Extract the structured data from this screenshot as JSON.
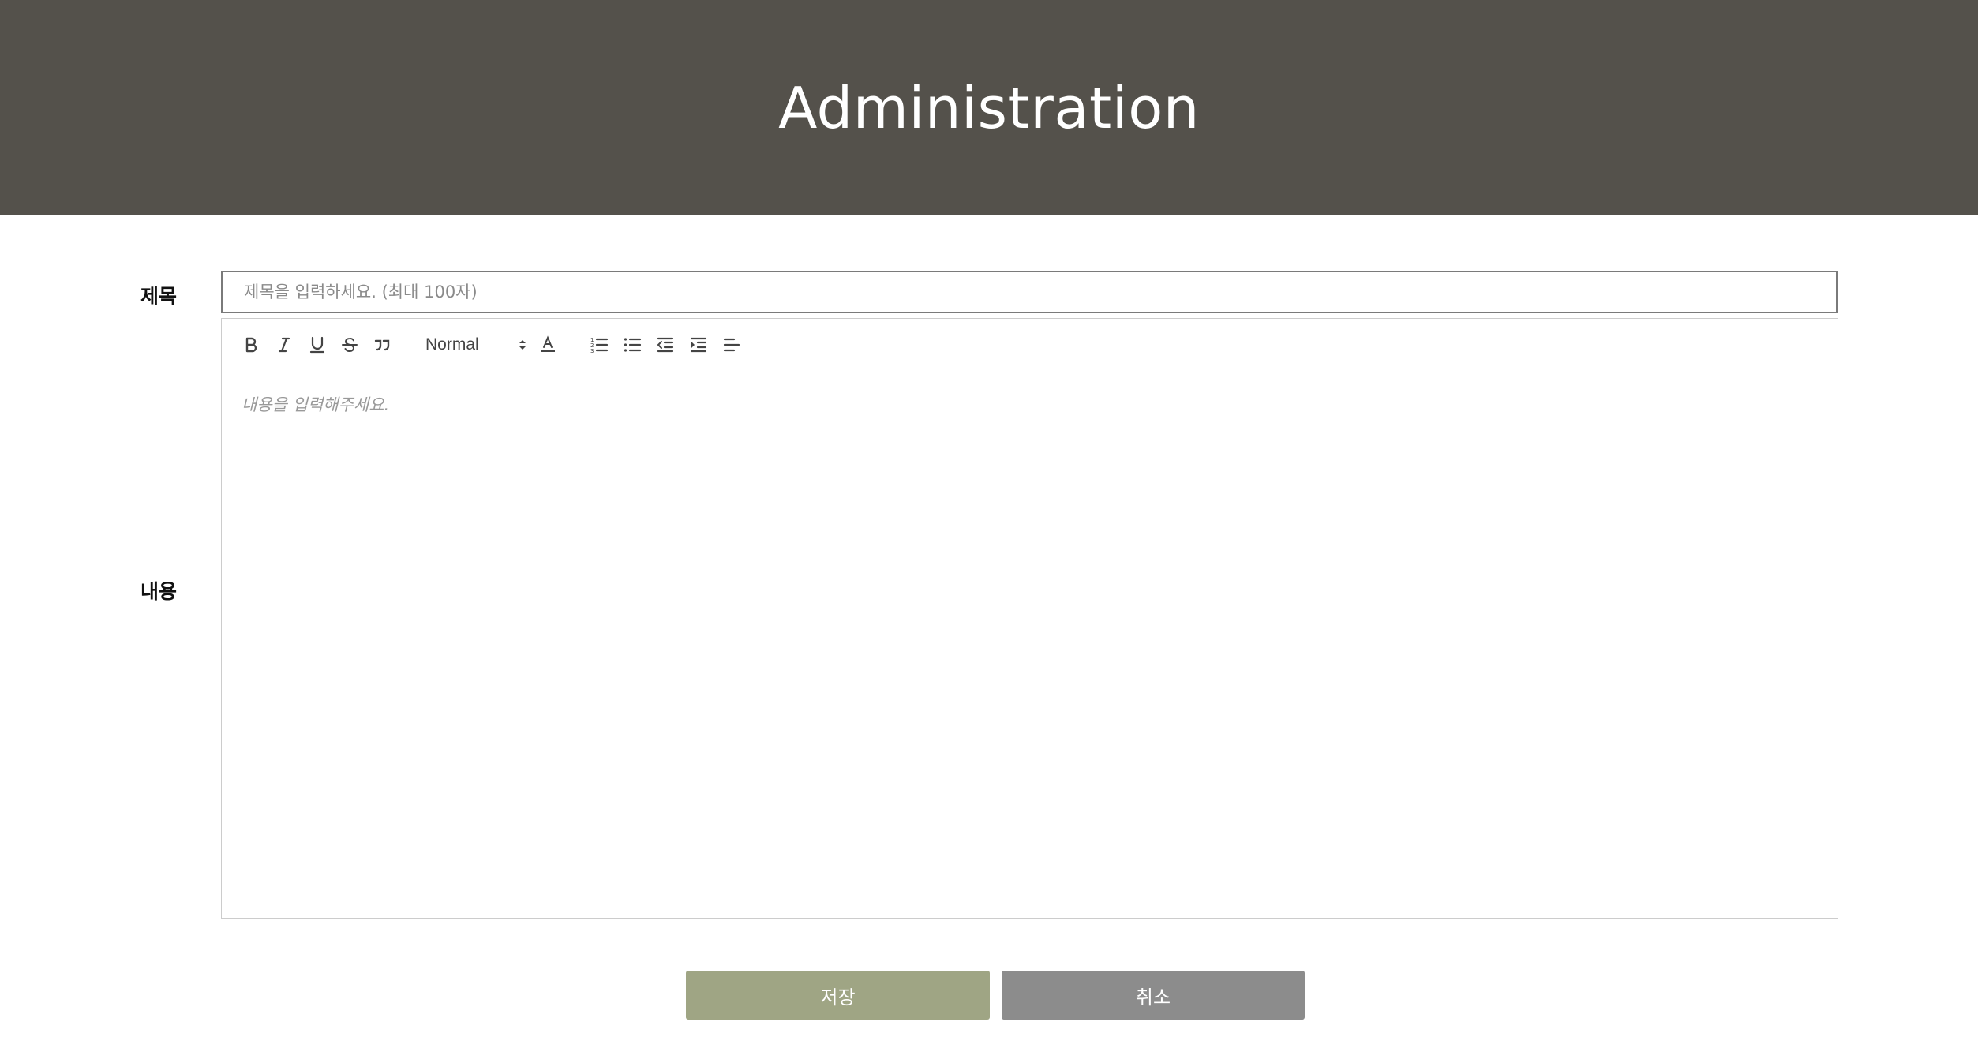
{
  "header": {
    "title": "Administration"
  },
  "form": {
    "title_label": "제목",
    "title_placeholder": "제목을 입력하세요. (최대 100자)",
    "title_value": "",
    "content_label": "내용",
    "content_placeholder": "내용을 입력해주세요."
  },
  "toolbar": {
    "buttons": [
      "bold-icon",
      "italic-icon",
      "underline-icon",
      "strikethrough-icon",
      "blockquote-icon"
    ],
    "header_select": {
      "selected": "Normal"
    },
    "color_button": "text-color-icon",
    "list_buttons": [
      "ordered-list-icon",
      "bullet-list-icon",
      "outdent-icon",
      "indent-icon",
      "align-icon"
    ]
  },
  "actions": {
    "save_label": "저장",
    "cancel_label": "취소"
  },
  "colors": {
    "header_bg": "#54514b",
    "save_button": "#9fa584",
    "cancel_button": "#8c8c8c"
  }
}
